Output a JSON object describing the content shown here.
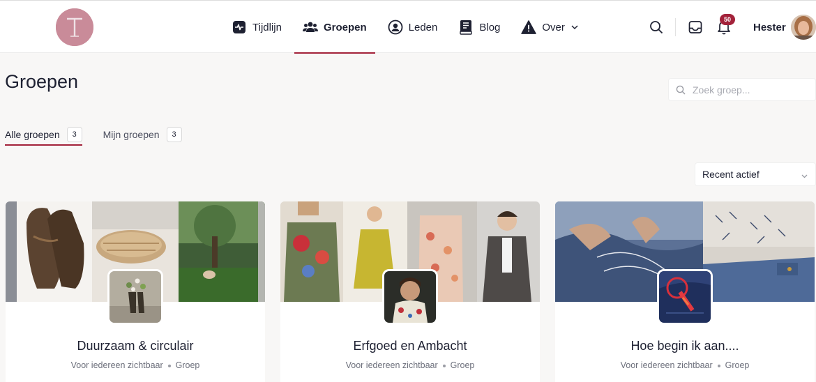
{
  "brand": {
    "logo_letter": "T"
  },
  "nav": {
    "items": [
      {
        "label": "Tijdlijn",
        "icon": "activity-icon",
        "active": false
      },
      {
        "label": "Groepen",
        "icon": "users-icon",
        "active": true
      },
      {
        "label": "Leden",
        "icon": "user-circle-icon",
        "active": false
      },
      {
        "label": "Blog",
        "icon": "book-icon",
        "active": false
      },
      {
        "label": "Over",
        "icon": "warning-icon",
        "active": false
      }
    ]
  },
  "header": {
    "notifications_count": "50",
    "user_name": "Hester"
  },
  "page": {
    "title": "Groepen",
    "search_placeholder": "Zoek groep...",
    "sort_label": "Recent actief"
  },
  "tabs": [
    {
      "label": "Alle groepen",
      "count": "3",
      "active": true
    },
    {
      "label": "Mijn groepen",
      "count": "3",
      "active": false
    }
  ],
  "groups": [
    {
      "title": "Duurzaam & circulair",
      "visibility": "Voor iedereen zichtbaar",
      "type": "Groep"
    },
    {
      "title": "Erfgoed en Ambacht",
      "visibility": "Voor iedereen zichtbaar",
      "type": "Groep"
    },
    {
      "title": "Hoe begin ik aan....",
      "visibility": "Voor iedereen zichtbaar",
      "type": "Groep"
    }
  ],
  "colors": {
    "accent": "#a3223a",
    "logo_bg": "#c98b99",
    "page_bg": "#f8f7f6",
    "text": "#1e2132"
  }
}
